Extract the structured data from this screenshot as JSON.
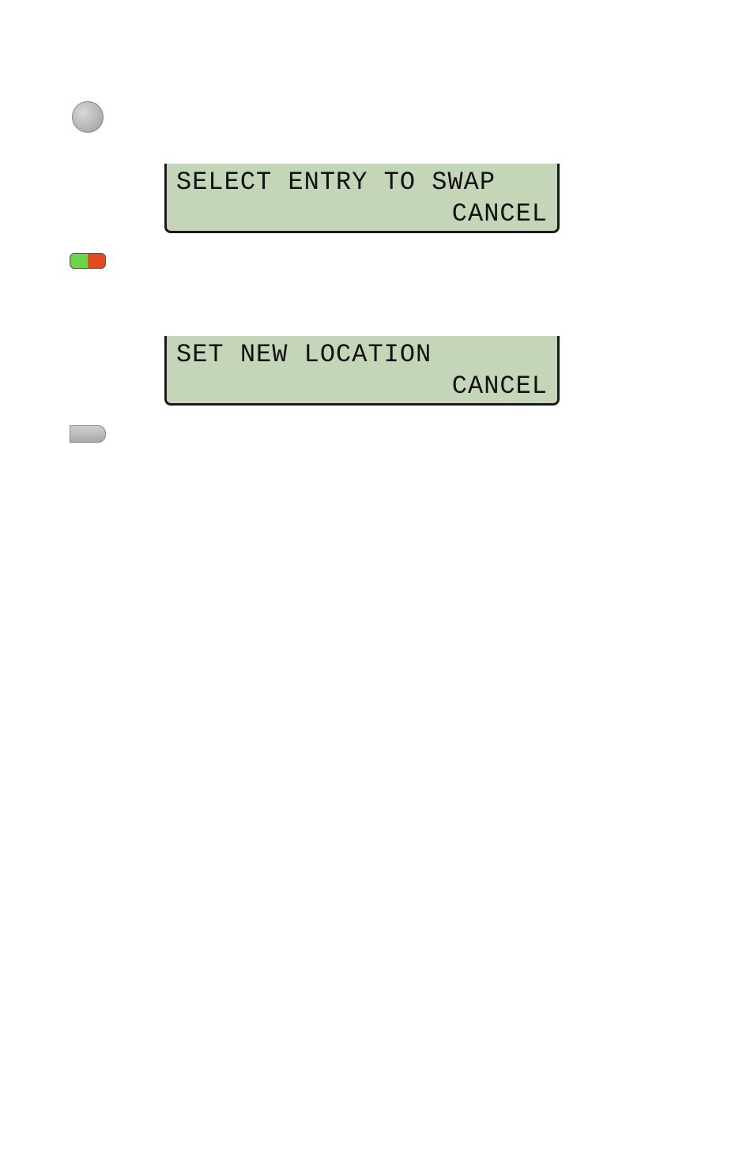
{
  "lcd1": {
    "line1": "SELECT ENTRY TO SWAP",
    "line2": "CANCEL"
  },
  "lcd2": {
    "line1": "SET NEW LOCATION",
    "line2": "CANCEL"
  }
}
